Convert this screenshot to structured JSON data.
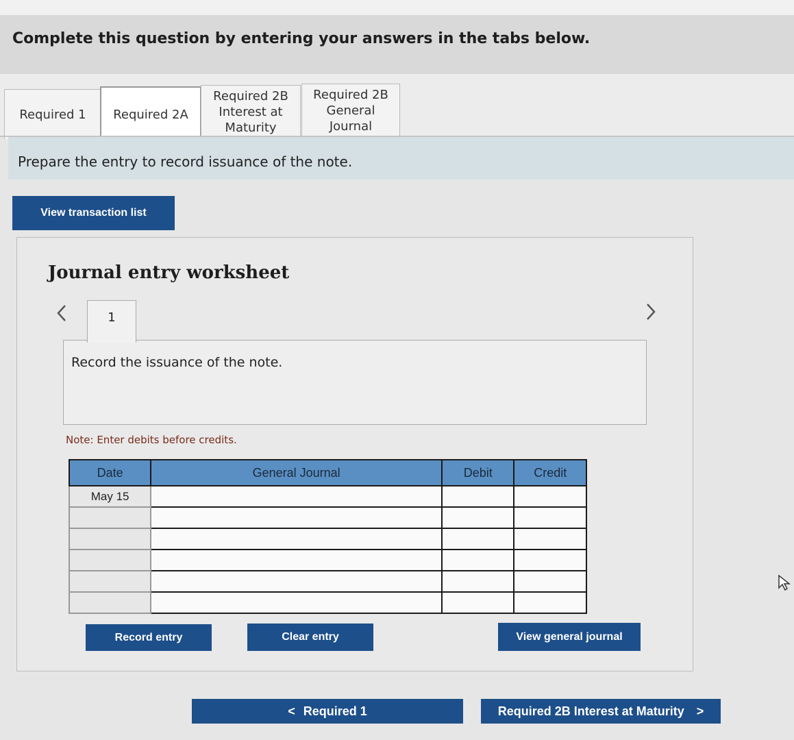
{
  "instruction": "Complete this question by entering your answers in the tabs below.",
  "tabs": [
    {
      "label": "Required 1",
      "active": false
    },
    {
      "label": "Required 2A",
      "active": true
    },
    {
      "label": "Required 2B\nInterest at\nMaturity",
      "active": false
    },
    {
      "label": "Required 2B\nGeneral\nJournal",
      "active": false
    }
  ],
  "prompt": "Prepare the entry to record issuance of the note.",
  "view_transaction_list": "View transaction list",
  "worksheet": {
    "title": "Journal entry worksheet",
    "entry_number": "1",
    "entry_description": "Record the issuance of the note.",
    "note": "Note: Enter debits before credits.",
    "columns": [
      "Date",
      "General Journal",
      "Debit",
      "Credit"
    ],
    "rows": [
      {
        "date": "May 15",
        "account": "",
        "debit": "",
        "credit": ""
      },
      {
        "date": "",
        "account": "",
        "debit": "",
        "credit": ""
      },
      {
        "date": "",
        "account": "",
        "debit": "",
        "credit": ""
      },
      {
        "date": "",
        "account": "",
        "debit": "",
        "credit": ""
      },
      {
        "date": "",
        "account": "",
        "debit": "",
        "credit": ""
      },
      {
        "date": "",
        "account": "",
        "debit": "",
        "credit": ""
      }
    ],
    "buttons": {
      "record": "Record entry",
      "clear": "Clear entry",
      "view_journal": "View general journal"
    }
  },
  "nav": {
    "prev": "Required 1",
    "next": "Required 2B Interest at Maturity"
  },
  "icons": {
    "prev": "chevron-left-icon",
    "next": "chevron-right-icon",
    "cursor": "mouse-cursor-icon"
  }
}
